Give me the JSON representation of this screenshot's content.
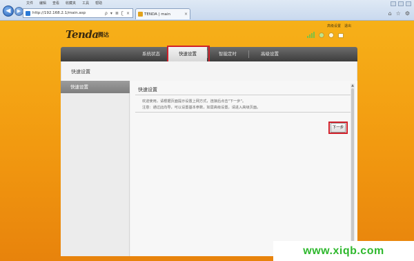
{
  "browser": {
    "address_url": "http://192.168.2.1/main.asp",
    "menu_items": [
      "文件",
      "编辑",
      "查看",
      "收藏夹",
      "工具",
      "帮助"
    ],
    "tab_title": "TENDA | main",
    "address_tools": [
      "ρ",
      "▾",
      "≣",
      "ʗ",
      "×"
    ]
  },
  "header": {
    "logo": "Tenda",
    "logo_cn": "腾达",
    "top_links": [
      "高级设置",
      "退出"
    ]
  },
  "nav": {
    "items": [
      "系统状态",
      "快速设置",
      "智能定时",
      "高级设置"
    ],
    "active_index": 1
  },
  "page_title": "快速设置",
  "sidebar": {
    "items": [
      "快速设置"
    ]
  },
  "content": {
    "title": "快速设置",
    "notice_lines": [
      "欢迎使用，请根据页面提示设置上网方式，连接后点击\"下一步\"。",
      "注意：通过此向导，可以设置基本参数，如需高级设置，请进入高级页面。"
    ],
    "next_label": "下一步"
  },
  "watermark": "www.xiqb.com",
  "colors": {
    "highlight": "#d0202a",
    "watermark": "#2fb82e",
    "background": "#f29a10"
  }
}
